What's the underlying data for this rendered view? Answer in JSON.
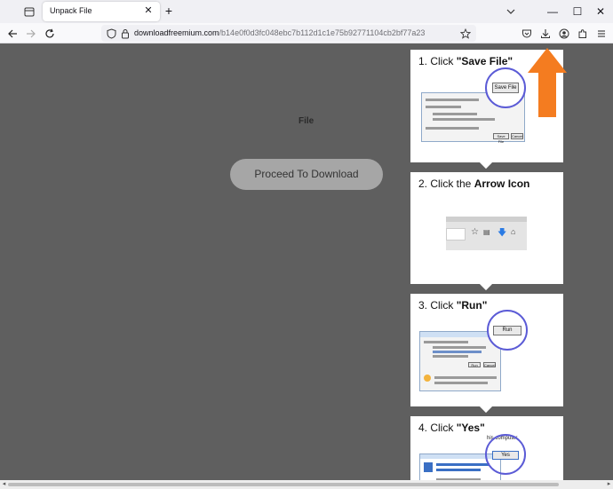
{
  "browser": {
    "tab": {
      "title": "Unpack File",
      "close": "✕"
    },
    "new_tab": "+",
    "window": {
      "minimize": "—",
      "maximize": "☐",
      "close": "✕"
    },
    "url": {
      "host": "downloadfreemium.com",
      "path": "/b14e0f0d3fc048ebc7b112d1c1e75b92771104cb2bf77a23"
    }
  },
  "page": {
    "file_label": "File",
    "proceed_button": "Proceed To Download"
  },
  "steps": [
    {
      "num": "1. Click ",
      "bold": "\"Save File\"",
      "button": "Save File"
    },
    {
      "num": "2. Click the ",
      "bold": "Arrow Icon"
    },
    {
      "num": "3. Click ",
      "bold": "\"Run\"",
      "button": "Run"
    },
    {
      "num": "4. Click ",
      "bold": "\"Yes\"",
      "button": "Yes",
      "snippet": "his computer"
    }
  ],
  "colors": {
    "accent_arrow": "#f47c20",
    "page_bg": "#5f5f5f",
    "proceed_bg": "#a6a6a6"
  }
}
